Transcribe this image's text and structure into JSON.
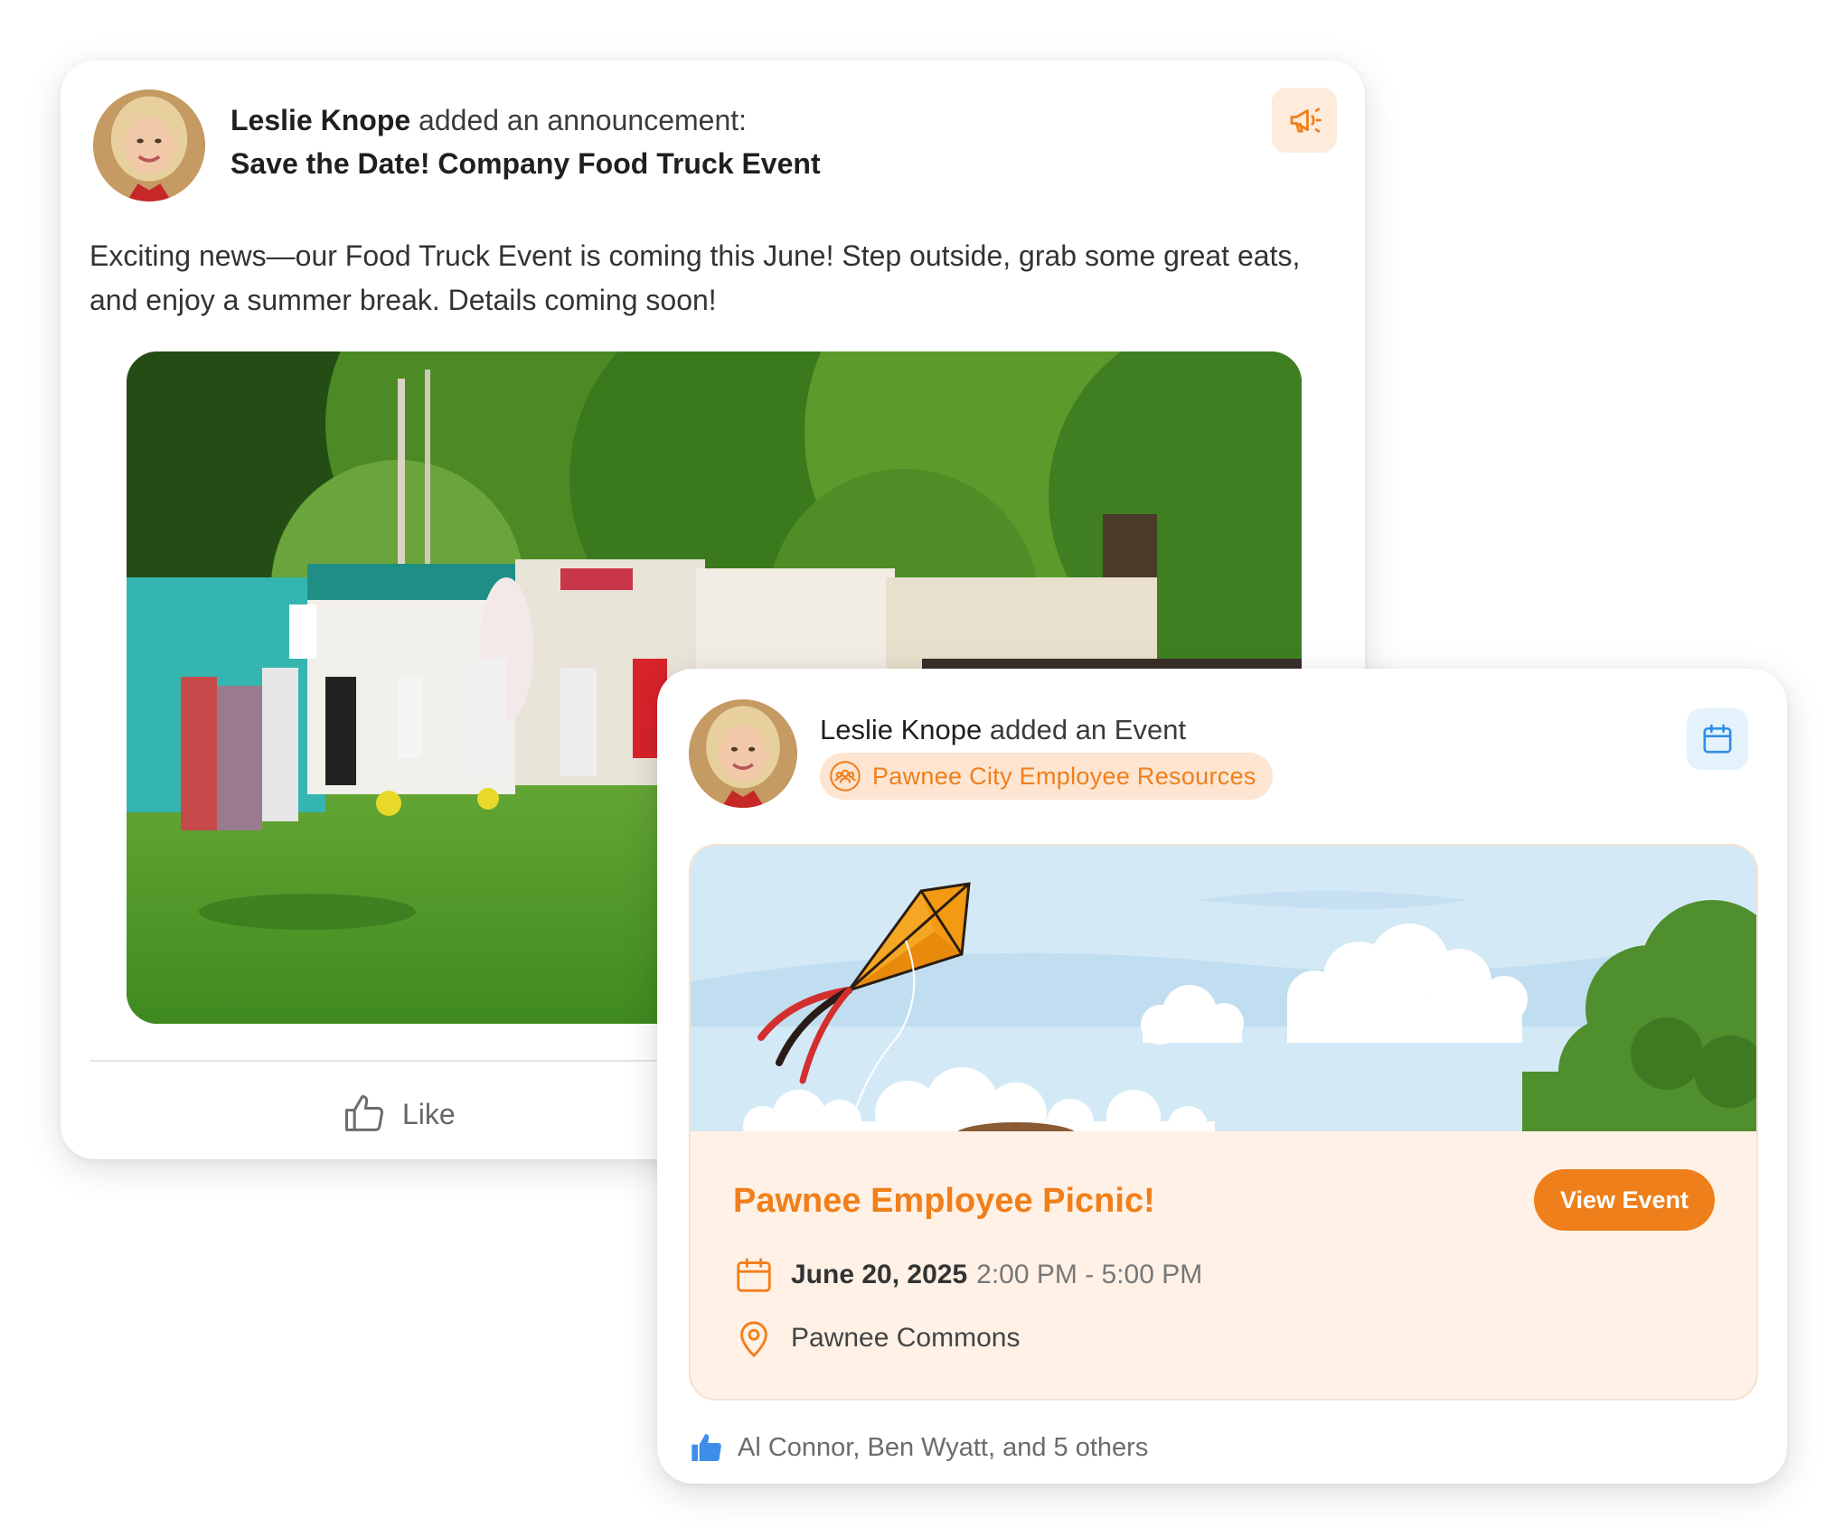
{
  "announcement": {
    "author": "Leslie Knope",
    "action": "added an announcement:",
    "title": "Save the Date! Company Food Truck Event",
    "body": "Exciting news—our Food Truck Event is coming this June! Step outside, grab some great eats, and enjoy a summer break. Details coming soon!",
    "type_icon": "megaphone-icon",
    "like_label": "Like"
  },
  "event_post": {
    "author": "Leslie Knope",
    "action": "added an Event",
    "group": "Pawnee City Employee Resources",
    "type_icon": "calendar-icon",
    "event": {
      "title": "Pawnee Employee Picnic!",
      "view_label": "View Event",
      "date": "June 20, 2025",
      "time": "2:00 PM - 5:00 PM",
      "location": "Pawnee Commons"
    },
    "reactions_text": "Al Connor, Ben Wyatt, and 5 others"
  },
  "colors": {
    "accent": "#ee7f1b",
    "accent_light": "#fde5d2",
    "event_bg": "#fff1e6",
    "like_blue": "#3d8ee8"
  }
}
